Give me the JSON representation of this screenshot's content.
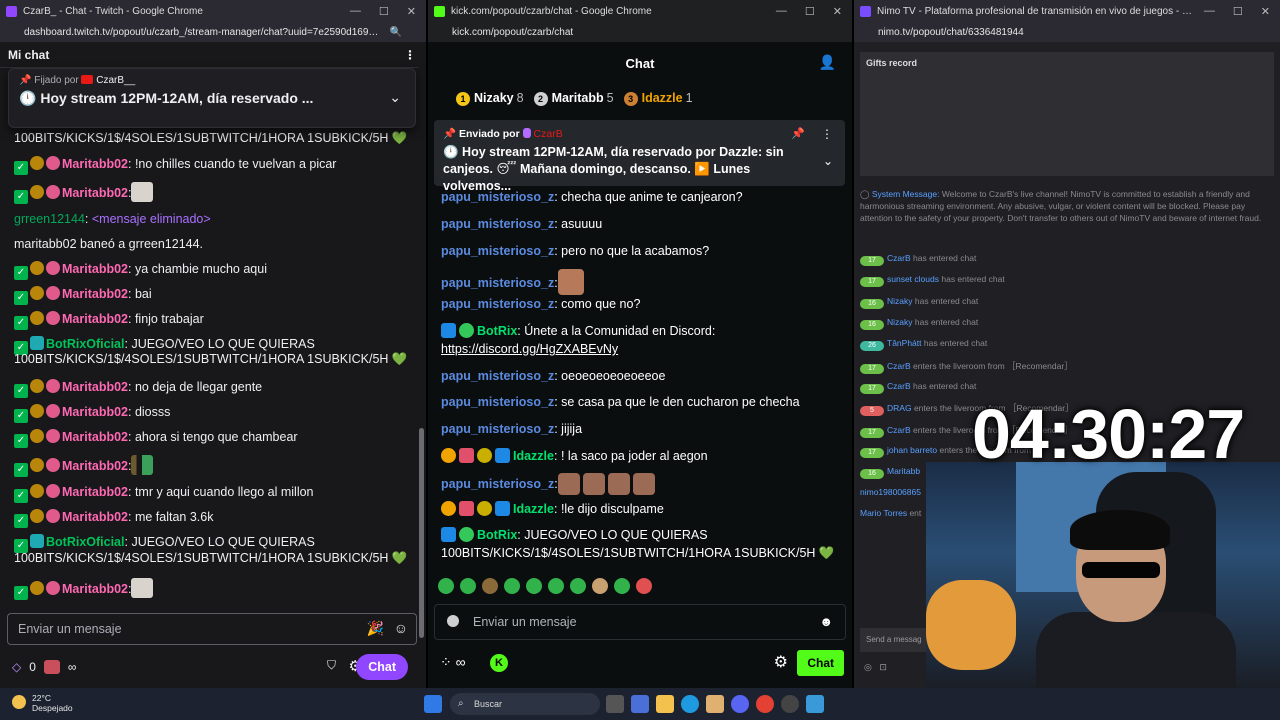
{
  "twitch": {
    "window_title": "CzarB_ - Chat - Twitch - Google Chrome",
    "url": "dashboard.twitch.tv/popout/u/czarb_/stream-manager/chat?uuid=7e2590d16914d8a5...",
    "header": "Mi chat",
    "pinned_by_label": "Fijado por",
    "pinned_by_user": "CzarB__",
    "pinned_message": "Hoy stream 12PM-12AM, día reservado ...",
    "messages": [
      {
        "user": "",
        "text": "100BITS/KICKS/1$/4SOLES/1SUBTWITCH/1HORA 1SUBKICK/5H 💚"
      },
      {
        "user": "Maritabb02",
        "text": ": !no chilles cuando te vuelvan a picar"
      },
      {
        "user": "Maritabb02",
        "text": ":"
      },
      {
        "user": "grreen12144",
        "text": "<mensaje eliminado>"
      },
      {
        "user": "",
        "text": "maritabb02 baneó a grreen12144."
      },
      {
        "user": "Maritabb02",
        "text": ": ya chambie mucho aqui"
      },
      {
        "user": "Maritabb02",
        "text": ": bai"
      },
      {
        "user": "Maritabb02",
        "text": ": finjo trabajar"
      },
      {
        "user": "BotRixOficial",
        "text": ": JUEGO/VEO LO QUE QUIERAS"
      },
      {
        "user": "",
        "text": "100BITS/KICKS/1$/4SOLES/1SUBTWITCH/1HORA 1SUBKICK/5H 💚"
      },
      {
        "user": "Maritabb02",
        "text": ": no deja de llegar gente"
      },
      {
        "user": "Maritabb02",
        "text": ": diosss"
      },
      {
        "user": "Maritabb02",
        "text": ": ahora si tengo que chambear"
      },
      {
        "user": "Maritabb02",
        "text": ":"
      },
      {
        "user": "Maritabb02",
        "text": ": tmr y aqui cuando llego al millon"
      },
      {
        "user": "Maritabb02",
        "text": ": me faltan 3.6k"
      },
      {
        "user": "BotRixOficial",
        "text": ": JUEGO/VEO LO QUE QUIERAS"
      },
      {
        "user": "",
        "text": "100BITS/KICKS/1$/4SOLES/1SUBTWITCH/1HORA 1SUBKICK/5H 💚"
      },
      {
        "user": "Maritabb02",
        "text": ":"
      }
    ],
    "input_placeholder": "Enviar un mensaje",
    "points": "0",
    "chat_button": "Chat"
  },
  "kick": {
    "window_title": "kick.com/popout/czarb/chat - Google Chrome",
    "url": "kick.com/popout/czarb/chat",
    "header": "Chat",
    "top_gifters": [
      {
        "rank": "1",
        "name": "Nizaky",
        "count": "8"
      },
      {
        "rank": "2",
        "name": "Maritabb",
        "count": "5"
      },
      {
        "rank": "3",
        "name": "Idazzle",
        "count": "1"
      }
    ],
    "pinned_label": "Enviado por",
    "pinned_user": "CzarB",
    "pinned_message": "Hoy stream 12PM-12AM, día reservado por Dazzle: sin canjeos. 😴 Mañana domingo, descanso. ▶️ Lunes volvemos...",
    "messages": [
      {
        "user": "papu_misterioso_z",
        "text": ": checha que anime te canjearon?"
      },
      {
        "user": "papu_misterioso_z",
        "text": ": asuuuu"
      },
      {
        "user": "papu_misterioso_z",
        "text": ": pero no que la acabamos?"
      },
      {
        "user": "papu_misterioso_z",
        "text": ":"
      },
      {
        "user": "papu_misterioso_z",
        "text": ": como que no?"
      },
      {
        "user": "BotRix",
        "text": ": Únete a la Comunidad en Discord:"
      },
      {
        "user": "",
        "text": "https://discord.gg/HgZXABEvNy"
      },
      {
        "user": "papu_misterioso_z",
        "text": ": oeoeoeoeoeoeeoe"
      },
      {
        "user": "papu_misterioso_z",
        "text": ": se casa pa que le den cucharon pe checha"
      },
      {
        "user": "papu_misterioso_z",
        "text": ": jijija"
      },
      {
        "user": "Idazzle",
        "text": ": ! la saco pa joder al aegon"
      },
      {
        "user": "papu_misterioso_z",
        "text": ":"
      },
      {
        "user": "Idazzle",
        "text": ": !le dijo disculpame"
      },
      {
        "user": "BotRix",
        "text": ": JUEGO/VEO LO QUE QUIERAS"
      },
      {
        "user": "",
        "text": "100BITS/KICKS/1$/4SOLES/1SUBTWITCH/1HORA 1SUBKICK/5H 💚"
      }
    ],
    "input_placeholder": "Enviar un mensaje",
    "chat_button": "Chat"
  },
  "nimo": {
    "window_title": "Nimo TV - Plataforma profesional de transmisión en vivo de juegos - Google Chrome",
    "url": "nimo.tv/popout/chat/6336481944",
    "gifts_title": "Gifts record",
    "system_label": "System Message:",
    "system_text": "Welcome to CzarB's live channel! NimoTV is committed to establish a friendly and harmonious streaming environment. Any abusive, vulgar, or violent content will be blocked. Please pay attention to the safety of your property. Don't transfer to others out of NimoTV and beware of internet fraud.",
    "events": [
      {
        "lv": "17",
        "user": "CzarB",
        "text": "has entered chat"
      },
      {
        "lv": "17",
        "user": "sunset clouds",
        "text": "has entered chat"
      },
      {
        "lv": "16",
        "user": "Nizaky",
        "text": "has entered chat"
      },
      {
        "lv": "16",
        "user": "Nizaky",
        "text": "has entered chat"
      },
      {
        "lv": "26",
        "user": "TânPhátt",
        "text": "has entered chat"
      },
      {
        "lv": "17",
        "user": "CzarB",
        "text": "enters the liveroom from ［Recomendar］"
      },
      {
        "lv": "17",
        "user": "CzarB",
        "text": "has entered chat"
      },
      {
        "lv": "5",
        "user": "DRAG",
        "text": "enters the liveroom from ［Recomendar］"
      },
      {
        "lv": "17",
        "user": "CzarB",
        "text": "enters the liveroom from ［Recomendar］"
      },
      {
        "lv": "17",
        "user": "johan barreto",
        "text": "enters the liveroom from"
      },
      {
        "lv": "16",
        "user": "Maritabb",
        "text": ""
      },
      {
        "lv": "",
        "user": "nimo198006865",
        "text": ""
      },
      {
        "lv": "",
        "user": "Mario Torres",
        "text": "ent"
      }
    ],
    "send_placeholder": "Send a messag"
  },
  "overlay": {
    "clock": "04:30:27"
  },
  "taskbar": {
    "temperature": "22°C",
    "condition": "Despejado",
    "search_label": "Buscar"
  }
}
